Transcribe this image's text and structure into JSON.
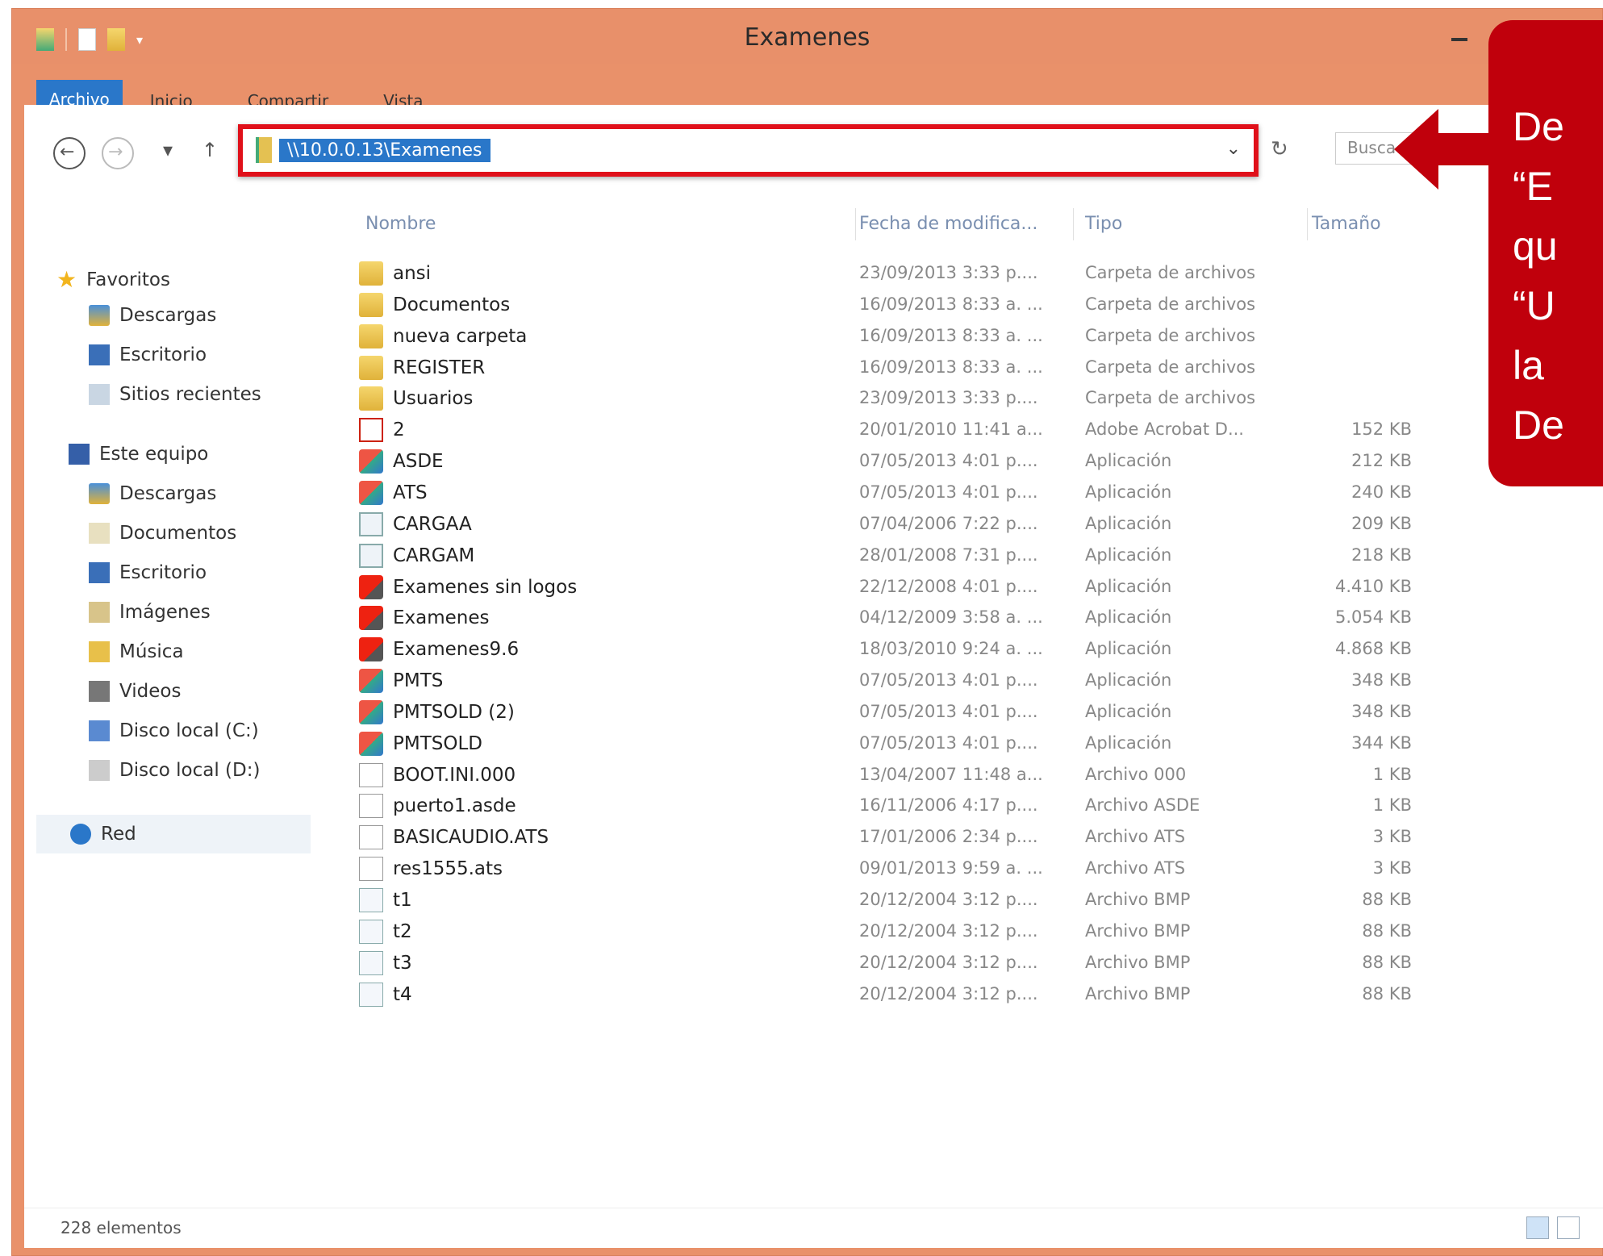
{
  "window": {
    "title": "Examenes"
  },
  "ribbon": {
    "tabs": [
      "Archivo",
      "Inicio",
      "Compartir",
      "Vista"
    ]
  },
  "address": {
    "path": "\\\\10.0.0.13\\Examenes"
  },
  "search": {
    "placeholder": "Busca"
  },
  "nav_pane": {
    "favorites_label": "Favoritos",
    "favorites": [
      "Descargas",
      "Escritorio",
      "Sitios recientes"
    ],
    "pc_label": "Este equipo",
    "pc_items": [
      "Descargas",
      "Documentos",
      "Escritorio",
      "Imágenes",
      "Música",
      "Videos",
      "Disco local (C:)",
      "Disco local (D:)"
    ],
    "network_label": "Red"
  },
  "columns": {
    "name": "Nombre",
    "date": "Fecha de modifica...",
    "type": "Tipo",
    "size": "Tamaño"
  },
  "files": [
    {
      "name": "ansi",
      "date": "23/09/2013 3:33 p....",
      "type": "Carpeta de archivos",
      "size": "",
      "icon": "folder-icon"
    },
    {
      "name": "Documentos",
      "date": "16/09/2013 8:33 a. ...",
      "type": "Carpeta de archivos",
      "size": "",
      "icon": "folder-icon"
    },
    {
      "name": "nueva carpeta",
      "date": "16/09/2013 8:33 a. ...",
      "type": "Carpeta de archivos",
      "size": "",
      "icon": "folder-icon"
    },
    {
      "name": "REGISTER",
      "date": "16/09/2013 8:33 a. ...",
      "type": "Carpeta de archivos",
      "size": "",
      "icon": "folder-icon"
    },
    {
      "name": "Usuarios",
      "date": "23/09/2013 3:33 p....",
      "type": "Carpeta de archivos",
      "size": "",
      "icon": "folder-icon"
    },
    {
      "name": "2",
      "date": "20/01/2010 11:41 a...",
      "type": "Adobe Acrobat D...",
      "size": "152 KB",
      "icon": "pdf-icon"
    },
    {
      "name": "ASDE",
      "date": "07/05/2013 4:01 p....",
      "type": "Aplicación",
      "size": "212 KB",
      "icon": "app-icon"
    },
    {
      "name": "ATS",
      "date": "07/05/2013 4:01 p....",
      "type": "Aplicación",
      "size": "240 KB",
      "icon": "app-icon"
    },
    {
      "name": "CARGAA",
      "date": "07/04/2006 7:22 p....",
      "type": "Aplicación",
      "size": "209 KB",
      "icon": "exe-icon"
    },
    {
      "name": "CARGAM",
      "date": "28/01/2008 7:31 p....",
      "type": "Aplicación",
      "size": "218 KB",
      "icon": "exe-icon"
    },
    {
      "name": "Examenes sin logos",
      "date": "22/12/2008 4:01 p....",
      "type": "Aplicación",
      "size": "4.410 KB",
      "icon": "app-red-icon"
    },
    {
      "name": "Examenes",
      "date": "04/12/2009 3:58 a. ...",
      "type": "Aplicación",
      "size": "5.054 KB",
      "icon": "app-red-icon"
    },
    {
      "name": "Examenes9.6",
      "date": "18/03/2010 9:24 a. ...",
      "type": "Aplicación",
      "size": "4.868 KB",
      "icon": "app-red-icon"
    },
    {
      "name": "PMTS",
      "date": "07/05/2013 4:01 p....",
      "type": "Aplicación",
      "size": "348 KB",
      "icon": "app-icon"
    },
    {
      "name": "PMTSOLD (2)",
      "date": "07/05/2013 4:01 p....",
      "type": "Aplicación",
      "size": "348 KB",
      "icon": "app-icon"
    },
    {
      "name": "PMTSOLD",
      "date": "07/05/2013 4:01 p....",
      "type": "Aplicación",
      "size": "344 KB",
      "icon": "app-icon"
    },
    {
      "name": "BOOT.INI.000",
      "date": "13/04/2007 11:48 a...",
      "type": "Archivo 000",
      "size": "1 KB",
      "icon": "file-icon"
    },
    {
      "name": "puerto1.asde",
      "date": "16/11/2006 4:17 p....",
      "type": "Archivo ASDE",
      "size": "1 KB",
      "icon": "file-icon"
    },
    {
      "name": "BASICAUDIO.ATS",
      "date": "17/01/2006 2:34 p....",
      "type": "Archivo ATS",
      "size": "3 KB",
      "icon": "file-icon"
    },
    {
      "name": "res1555.ats",
      "date": "09/01/2013 9:59 a. ...",
      "type": "Archivo ATS",
      "size": "3 KB",
      "icon": "file-icon"
    },
    {
      "name": "t1",
      "date": "20/12/2004 3:12 p....",
      "type": "Archivo BMP",
      "size": "88 KB",
      "icon": "bmp-icon"
    },
    {
      "name": "t2",
      "date": "20/12/2004 3:12 p....",
      "type": "Archivo BMP",
      "size": "88 KB",
      "icon": "bmp-icon"
    },
    {
      "name": "t3",
      "date": "20/12/2004 3:12 p....",
      "type": "Archivo BMP",
      "size": "88 KB",
      "icon": "bmp-icon"
    },
    {
      "name": "t4",
      "date": "20/12/2004 3:12 p....",
      "type": "Archivo BMP",
      "size": "88 KB",
      "icon": "bmp-icon"
    }
  ],
  "status": {
    "count": "228 elementos"
  },
  "callout": {
    "lines": [
      "De",
      "“E",
      "qu",
      "“U",
      "la",
      "De"
    ],
    "color": "#c0000c"
  },
  "colors": {
    "titlebar": "#e8906a",
    "accent": "#2a77c9",
    "highlight": "#e0101a"
  }
}
